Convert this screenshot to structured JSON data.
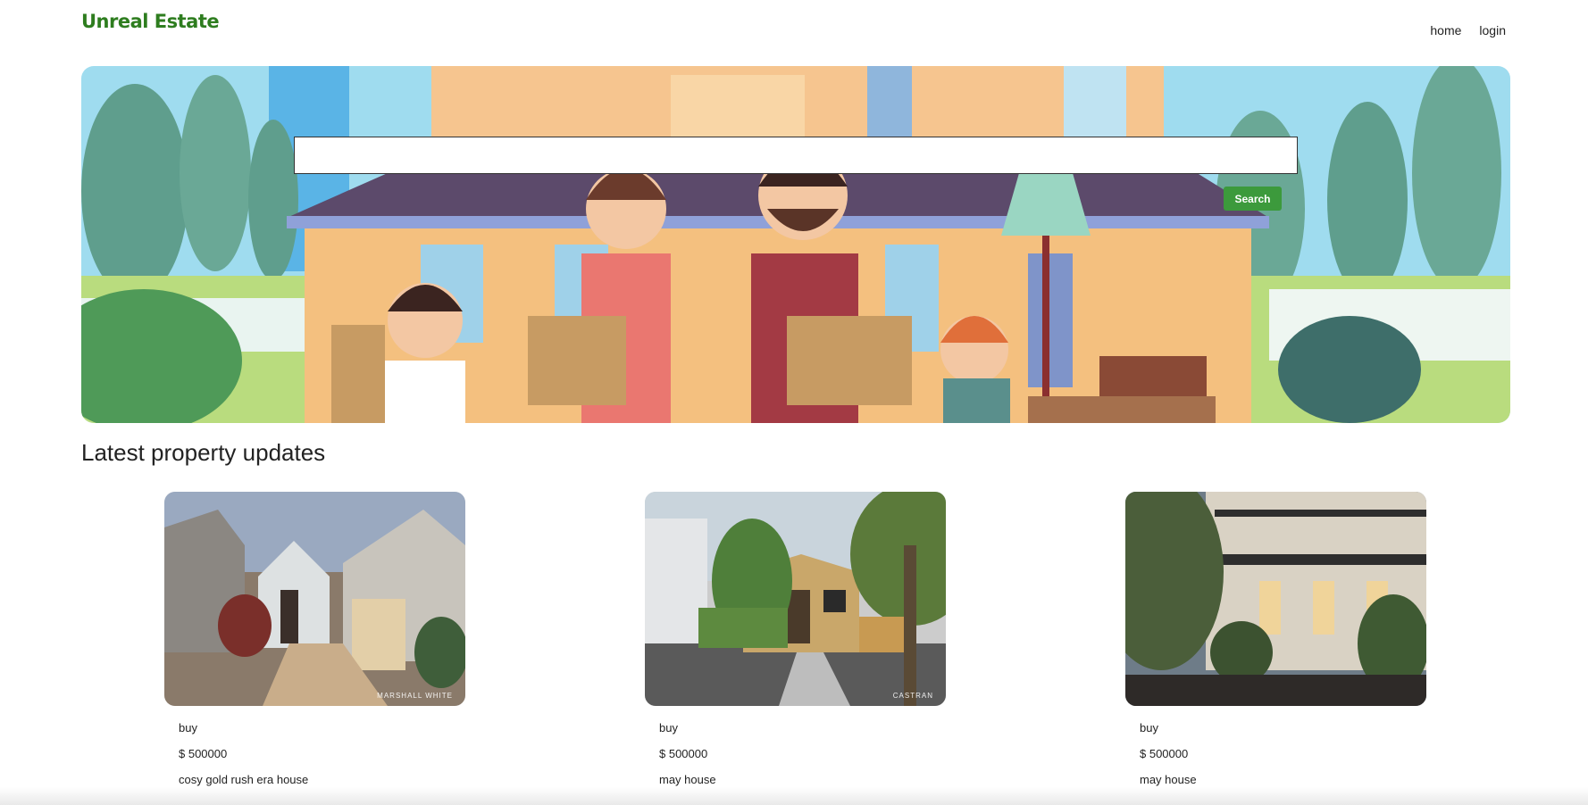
{
  "brand": {
    "name": "Unreal Estate",
    "color": "#2e7d1f"
  },
  "nav": {
    "items": [
      {
        "label": "home"
      },
      {
        "label": "login"
      }
    ]
  },
  "hero": {
    "search_value": "",
    "search_placeholder": "",
    "search_button": "Search"
  },
  "section": {
    "title": "Latest property updates"
  },
  "listings": [
    {
      "type": "buy",
      "price": "$ 500000",
      "title": "cosy gold rush era house",
      "watermark": "MARSHALL WHITE"
    },
    {
      "type": "buy",
      "price": "$ 500000",
      "title": "may house",
      "watermark": "CASTRAN"
    },
    {
      "type": "buy",
      "price": "$ 500000",
      "title": "may house",
      "watermark": ""
    }
  ],
  "colors": {
    "accent": "#3c9a3c",
    "text": "#222222"
  }
}
